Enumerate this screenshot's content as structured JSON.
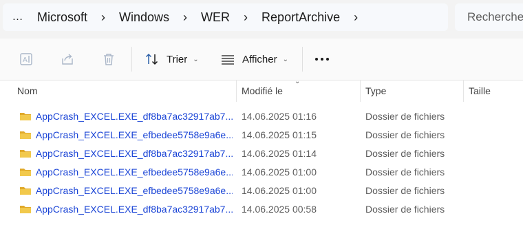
{
  "address_bar": {
    "overflow": "…",
    "crumbs": [
      "Microsoft",
      "Windows",
      "WER",
      "ReportArchive"
    ],
    "separator": "›"
  },
  "search": {
    "placeholder": "Rechercher"
  },
  "commands": {
    "sort_label": "Trier",
    "view_label": "Afficher"
  },
  "columns": {
    "name": "Nom",
    "modified": "Modifié le",
    "type": "Type",
    "size": "Taille"
  },
  "rows": [
    {
      "name": "AppCrash_EXCEL.EXE_df8ba7ac32917ab7...",
      "modified": "14.06.2025 01:16",
      "type": "Dossier de fichiers",
      "size": ""
    },
    {
      "name": "AppCrash_EXCEL.EXE_efbedee5758e9a6e...",
      "modified": "14.06.2025 01:15",
      "type": "Dossier de fichiers",
      "size": ""
    },
    {
      "name": "AppCrash_EXCEL.EXE_df8ba7ac32917ab7...",
      "modified": "14.06.2025 01:14",
      "type": "Dossier de fichiers",
      "size": ""
    },
    {
      "name": "AppCrash_EXCEL.EXE_efbedee5758e9a6e...",
      "modified": "14.06.2025 01:00",
      "type": "Dossier de fichiers",
      "size": ""
    },
    {
      "name": "AppCrash_EXCEL.EXE_efbedee5758e9a6e...",
      "modified": "14.06.2025 01:00",
      "type": "Dossier de fichiers",
      "size": ""
    },
    {
      "name": "AppCrash_EXCEL.EXE_df8ba7ac32917ab7...",
      "modified": "14.06.2025 00:58",
      "type": "Dossier de fichiers",
      "size": ""
    }
  ],
  "colors": {
    "link": "#1a44d6",
    "folder": "#f2c94c",
    "folder_dark": "#e0a92a"
  }
}
